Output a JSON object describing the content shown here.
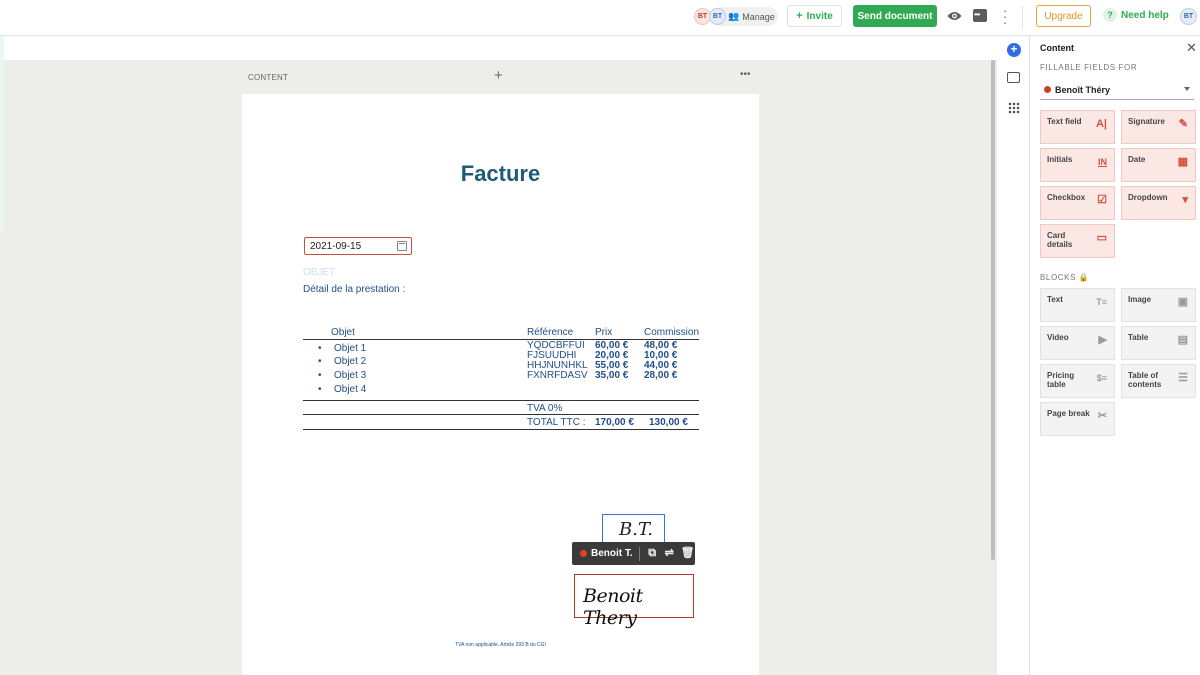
{
  "header": {
    "avatar1": "BT",
    "avatar2": "BT",
    "manage_label": "Manage",
    "invite_label": "Invite",
    "send_label": "Send document",
    "upgrade_label": "Upgrade",
    "help_label": "Need help",
    "user_avatar": "BT"
  },
  "editor": {
    "content_label": "CONTENT",
    "title": "Facture",
    "date_value": "2021-09-15",
    "objet_placeholder": "OBJET",
    "detail_text": "Détail de la prestation :",
    "table": {
      "headers": [
        "Objet",
        "Référence",
        "Prix",
        "Commission"
      ],
      "items": [
        "Objet 1",
        "Objet 2",
        "Objet 3",
        "Objet 4"
      ],
      "references": [
        "YQDCBFFUI",
        "FJSUUDHI",
        "HHJNUNHKL",
        "FXNRFDASV"
      ],
      "prices": [
        "60,00 €",
        "20,00 €",
        "55,00 €",
        "35,00 €"
      ],
      "commissions": [
        "48,00 €",
        "10,00 €",
        "44,00 €",
        "28,00 €"
      ],
      "tva_label": "TVA 0%",
      "total_label": "TOTAL  TTC :",
      "total_price": "170,00 €",
      "total_commission": "130,00 €"
    },
    "initials_sig": "B.T.",
    "toolbar_name": "Benoit T.",
    "signature": "Benoit Thery",
    "footer_note": "TVA non applicable. Article 293 B du CGI"
  },
  "panel": {
    "title": "Content",
    "fillable_label": "FILLABLE FIELDS FOR",
    "recipient": "Benoît Théry",
    "fields": [
      {
        "label": "Text field",
        "icon": "text-field-icon",
        "glyph": "A|"
      },
      {
        "label": "Signature",
        "icon": "pen-icon",
        "glyph": "✎"
      },
      {
        "label": "Initials",
        "icon": "initials-icon",
        "glyph": "IN"
      },
      {
        "label": "Date",
        "icon": "calendar-icon",
        "glyph": "▦"
      },
      {
        "label": "Checkbox",
        "icon": "checkbox-icon",
        "glyph": "☑"
      },
      {
        "label": "Dropdown",
        "icon": "dropdown-icon",
        "glyph": "▾"
      },
      {
        "label": "Card details",
        "icon": "card-icon",
        "glyph": "▭"
      }
    ],
    "blocks_label": "BLOCKS",
    "blocks": [
      {
        "label": "Text",
        "icon": "text-block-icon",
        "glyph": "T≡"
      },
      {
        "label": "Image",
        "icon": "image-icon",
        "glyph": "▣"
      },
      {
        "label": "Video",
        "icon": "video-icon",
        "glyph": "▶"
      },
      {
        "label": "Table",
        "icon": "table-icon",
        "glyph": "▤"
      },
      {
        "label": "Pricing table",
        "icon": "pricing-table-icon",
        "glyph": "$≡"
      },
      {
        "label": "Table of contents",
        "icon": "toc-icon",
        "glyph": "☰"
      },
      {
        "label": "Page break",
        "icon": "scissors-icon",
        "glyph": "✂"
      }
    ]
  },
  "colors": {
    "accent_green": "#2faa52",
    "title_blue": "#1f5a78",
    "field_red": "#c0533c",
    "upgrade_orange": "#e29424"
  }
}
